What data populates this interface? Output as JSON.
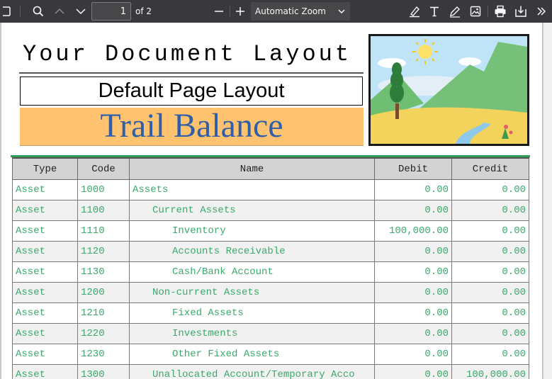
{
  "toolbar": {
    "page_number": "1",
    "page_count": "of 2",
    "zoom": "Automatic Zoom",
    "icons": {
      "sidebar": "sidebar-toggle-icon",
      "search": "search-icon",
      "previous": "chevron-up-icon",
      "next": "chevron-down-icon",
      "zoom_out": "minus-icon",
      "zoom_in": "plus-icon",
      "highlight": "highlight-icon",
      "text": "text-icon",
      "draw": "pen-icon",
      "image": "image-icon",
      "print": "print-icon",
      "save": "download-icon",
      "more": "double-chevron-right-icon"
    }
  },
  "document": {
    "heading": "Your Document Layout",
    "subtitle": "Default Page Layout",
    "title": "Trail Balance",
    "colors": {
      "title_band": "#ffc26e",
      "title_text": "#2f5fa8",
      "row_text": "#3aa96b",
      "accent_rule": "#2e9e58"
    }
  },
  "table": {
    "columns": [
      "Type",
      "Code",
      "Name",
      "Debit",
      "Credit"
    ],
    "rows": [
      {
        "type": "Asset",
        "code": "1000",
        "name": "Assets",
        "level": 0,
        "debit": "0.00",
        "credit": "0.00"
      },
      {
        "type": "Asset",
        "code": "1100",
        "name": "Current Assets",
        "level": 1,
        "debit": "0.00",
        "credit": "0.00"
      },
      {
        "type": "Asset",
        "code": "1110",
        "name": "Inventory",
        "level": 2,
        "debit": "100,000.00",
        "credit": "0.00"
      },
      {
        "type": "Asset",
        "code": "1120",
        "name": "Accounts Receivable",
        "level": 2,
        "debit": "0.00",
        "credit": "0.00"
      },
      {
        "type": "Asset",
        "code": "1130",
        "name": "Cash/Bank Account",
        "level": 2,
        "debit": "0.00",
        "credit": "0.00"
      },
      {
        "type": "Asset",
        "code": "1200",
        "name": "Non-current Assets",
        "level": 1,
        "debit": "0.00",
        "credit": "0.00"
      },
      {
        "type": "Asset",
        "code": "1210",
        "name": "Fixed Assets",
        "level": 2,
        "debit": "0.00",
        "credit": "0.00"
      },
      {
        "type": "Asset",
        "code": "1220",
        "name": "Investments",
        "level": 2,
        "debit": "0.00",
        "credit": "0.00"
      },
      {
        "type": "Asset",
        "code": "1230",
        "name": "Other Fixed Assets",
        "level": 2,
        "debit": "0.00",
        "credit": "0.00"
      },
      {
        "type": "Asset",
        "code": "1300",
        "name": "Unallocated Account/Temporary Acco",
        "level": 1,
        "debit": "0.00",
        "credit": "100,000.00"
      }
    ]
  }
}
